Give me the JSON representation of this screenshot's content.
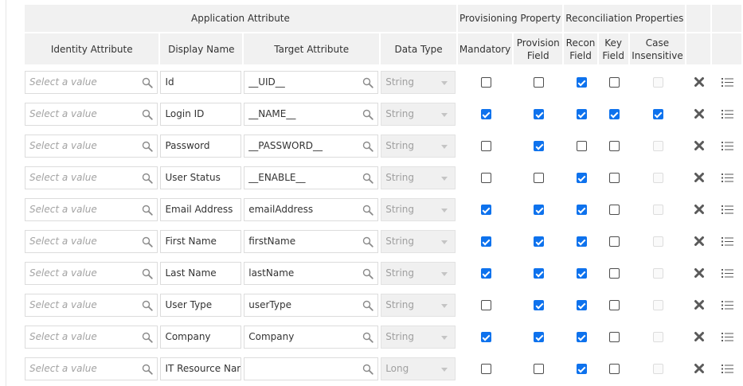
{
  "headers": {
    "group_application_attribute": "Application Attribute",
    "group_provisioning_property": "Provisioning Property",
    "group_reconciliation_properties": "Reconciliation Properties",
    "identity_attribute": "Identity Attribute",
    "display_name": "Display Name",
    "target_attribute": "Target Attribute",
    "data_type": "Data Type",
    "mandatory": "Mandatory",
    "provision_field_1": "Provision",
    "provision_field_2": "Field",
    "recon_field_1": "Recon",
    "recon_field_2": "Field",
    "key_field_1": "Key",
    "key_field_2": "Field",
    "case_insensitive_1": "Case",
    "case_insensitive_2": "Insensitive"
  },
  "placeholder": "Select a value",
  "icons": {
    "search": "search-icon",
    "dropdown": "chevron-down-icon",
    "delete": "close-icon",
    "details": "list-icon"
  },
  "colors": {
    "checkbox_checked": "#0e72ed",
    "header_bg": "#f1f1f1",
    "action_icon": "#5a5a5a"
  },
  "rows": [
    {
      "display_name": "Id",
      "target_attribute": "__UID__",
      "data_type": "String",
      "mandatory": false,
      "provision_field": false,
      "recon_field": true,
      "key_field": false,
      "case_insensitive": false,
      "case_insensitive_enabled": false
    },
    {
      "display_name": "Login ID",
      "target_attribute": "__NAME__",
      "data_type": "String",
      "mandatory": true,
      "provision_field": true,
      "recon_field": true,
      "key_field": true,
      "case_insensitive": true,
      "case_insensitive_enabled": true
    },
    {
      "display_name": "Password",
      "target_attribute": "__PASSWORD__",
      "data_type": "String",
      "mandatory": false,
      "provision_field": true,
      "recon_field": false,
      "key_field": false,
      "case_insensitive": false,
      "case_insensitive_enabled": false
    },
    {
      "display_name": "User Status",
      "target_attribute": "__ENABLE__",
      "data_type": "String",
      "mandatory": false,
      "provision_field": false,
      "recon_field": true,
      "key_field": false,
      "case_insensitive": false,
      "case_insensitive_enabled": false
    },
    {
      "display_name": "Email Address",
      "target_attribute": "emailAddress",
      "data_type": "String",
      "mandatory": true,
      "provision_field": true,
      "recon_field": true,
      "key_field": false,
      "case_insensitive": false,
      "case_insensitive_enabled": false
    },
    {
      "display_name": "First Name",
      "target_attribute": "firstName",
      "data_type": "String",
      "mandatory": true,
      "provision_field": true,
      "recon_field": true,
      "key_field": false,
      "case_insensitive": false,
      "case_insensitive_enabled": false
    },
    {
      "display_name": "Last Name",
      "target_attribute": "lastName",
      "data_type": "String",
      "mandatory": true,
      "provision_field": true,
      "recon_field": true,
      "key_field": false,
      "case_insensitive": false,
      "case_insensitive_enabled": false
    },
    {
      "display_name": "User Type",
      "target_attribute": "userType",
      "data_type": "String",
      "mandatory": false,
      "provision_field": true,
      "recon_field": true,
      "key_field": false,
      "case_insensitive": false,
      "case_insensitive_enabled": false
    },
    {
      "display_name": "Company",
      "target_attribute": "Company",
      "data_type": "String",
      "mandatory": true,
      "provision_field": true,
      "recon_field": true,
      "key_field": false,
      "case_insensitive": false,
      "case_insensitive_enabled": false
    },
    {
      "display_name": "IT Resource Nar",
      "target_attribute": "",
      "data_type": "Long",
      "mandatory": false,
      "provision_field": false,
      "recon_field": true,
      "key_field": false,
      "case_insensitive": false,
      "case_insensitive_enabled": false
    }
  ]
}
